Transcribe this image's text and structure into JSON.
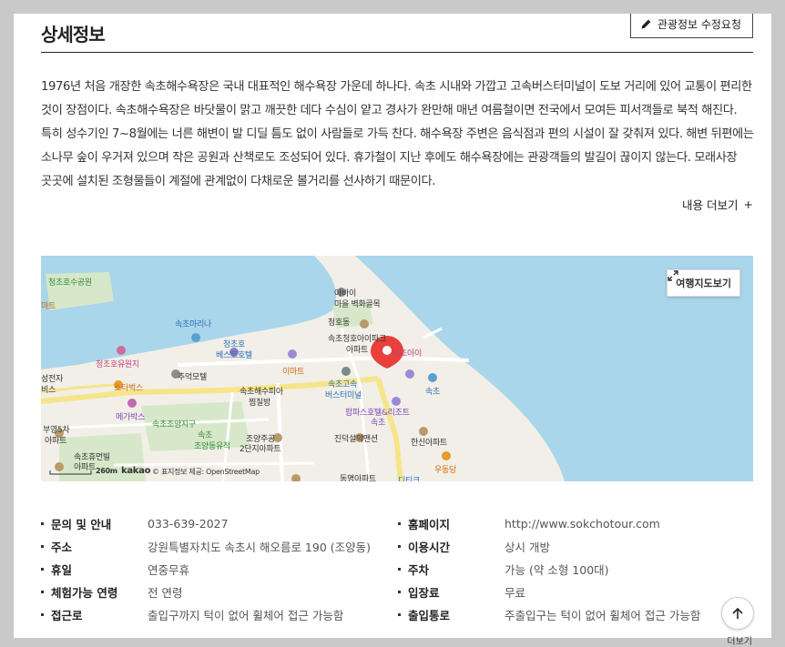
{
  "section": {
    "title": "상세정보",
    "edit_button": "관광정보 수정요청"
  },
  "description": "1976년 처음 개장한 속초해수욕장은 국내 대표적인 해수욕장 가운데 하나다. 속초 시내와 가깝고 고속버스터미널이 도보 거리에 있어 교통이 편리한 것이 장점이다. 속초해수욕장은 바닷물이 맑고 깨끗한 데다 수심이 얕고 경사가 완만해 매년 여름철이면 전국에서 모여든 피서객들로 북적 해진다. 특히 성수기인 7~8월에는 너른 해변이 발 디딜 틈도 없이 사람들로 가득 찬다. 해수욕장 주변은 음식점과 편의 시설이 잘 갖춰져 있다. 해변 뒤편에는 소나무 숲이 우거져 있으며 작은 공원과 산책로도 조성되어 있다. 휴가철이 지난 후에도 해수욕장에는 관광객들의 발길이 끊이지 않는다. 모래사장 곳곳에 설치된 조형물들이 계절에 관계없이 다채로운 볼거리를 선사하기 때문이다.",
  "more_label": "내용 더보기",
  "more_icon": "+",
  "map": {
    "button": "여행지도보기",
    "scale": "260m",
    "attribution": "kakao",
    "attribution2": "© 표지정보 제공: OpenStreetMap",
    "labels": {
      "l1": "청초호수공원",
      "l2": "아바이",
      "l3": "마을 벽화골목",
      "l4": "속초마리나",
      "l5": "청호동",
      "l6": "속초청호아이파크",
      "l7": "아파트",
      "l8": "속초아이",
      "l9": "청초호",
      "l10": "베스트호텔",
      "l11": "청초호유원지",
      "l12": "이마트",
      "l13": "추억모텔",
      "l14": "스타벅스",
      "l15": "속초해수피아",
      "l16": "찜질방",
      "l17": "속초고속",
      "l18": "버스터미널",
      "l19": "속초",
      "l20": "메가박스",
      "l21": "팜파스호텔&리조트",
      "l22": "속초",
      "l23": "속초조양지구",
      "l24": "조양주공",
      "l25": "2단지아파트",
      "l26": "속초",
      "l27": "조양동유적",
      "l28": "진덕설악맨션",
      "l29": "한신아파트",
      "l30": "부영5차",
      "l31": "아파트",
      "l32": "속초휴먼빌",
      "l33": "아파트",
      "l34": "우동당",
      "l35": "동명아파트",
      "l36": "마트",
      "l37": "성전자",
      "l38": "비스",
      "l39": "디티크"
    }
  },
  "info": {
    "left": [
      {
        "key": "문의 및 안내",
        "value": "033-639-2027"
      },
      {
        "key": "주소",
        "value": "강원특별자치도 속초시 해오름로 190 (조양동)"
      },
      {
        "key": "휴일",
        "value": "연중무휴"
      },
      {
        "key": "체험가능 연령",
        "value": "전 연령"
      },
      {
        "key": "접근로",
        "value": "출입구까지 턱이 없어 휠체어 접근 가능함"
      }
    ],
    "right": [
      {
        "key": "홈페이지",
        "value": "http://www.sokchotour.com"
      },
      {
        "key": "이용시간",
        "value": "상시 개방"
      },
      {
        "key": "주차",
        "value": "가능 (약 소형 100대)"
      },
      {
        "key": "입장료",
        "value": "무료"
      },
      {
        "key": "출입통로",
        "value": "주출입구는 턱이 없어 휠체어 접근 가능함"
      }
    ]
  },
  "footer_cut": "더보기",
  "colors": {
    "sea": "#a9d6ea",
    "road": "#f6e48a",
    "park": "#d6e8c9",
    "marker": "#e8403c"
  }
}
